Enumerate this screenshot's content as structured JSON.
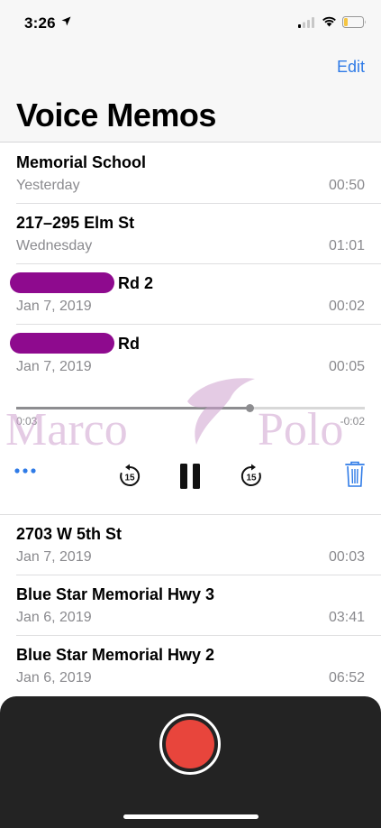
{
  "status_bar": {
    "time": "3:26",
    "icons": [
      "location-arrow-icon",
      "cellular-signal-icon",
      "wifi-icon",
      "battery-icon"
    ],
    "battery_level": 0.2,
    "battery_color": "#f5c542"
  },
  "nav": {
    "edit_label": "Edit",
    "title": "Voice Memos"
  },
  "memos_above": [
    {
      "title": "Memorial School",
      "date": "Yesterday",
      "duration": "00:50",
      "redacted": false
    },
    {
      "title": "217–295 Elm St",
      "date": "Wednesday",
      "duration": "01:01",
      "redacted": false
    },
    {
      "title": "Rd 2",
      "date": "Jan 7, 2019",
      "duration": "00:02",
      "redacted": true
    },
    {
      "title": "Rd",
      "date": "Jan 7, 2019",
      "duration": "00:05",
      "redacted": true
    }
  ],
  "player": {
    "elapsed": "0:03",
    "remaining": "-0:02",
    "progress": 0.67,
    "watermark": "Marco Polo",
    "skip_back_seconds": "15",
    "skip_forward_seconds": "15",
    "controls": [
      "more-icon",
      "skip-back-15-icon",
      "pause-icon",
      "skip-forward-15-icon",
      "trash-icon"
    ],
    "accent_color": "#2f7be7"
  },
  "memos_below": [
    {
      "title": "2703 W 5th St",
      "date": "Jan 7, 2019",
      "duration": "00:03"
    },
    {
      "title": "Blue Star Memorial Hwy 3",
      "date": "Jan 6, 2019",
      "duration": "03:41"
    },
    {
      "title": "Blue Star Memorial Hwy 2",
      "date": "Jan 6, 2019",
      "duration": "06:52"
    }
  ],
  "record": {
    "icon": "record-icon",
    "color": "#e8453c"
  }
}
